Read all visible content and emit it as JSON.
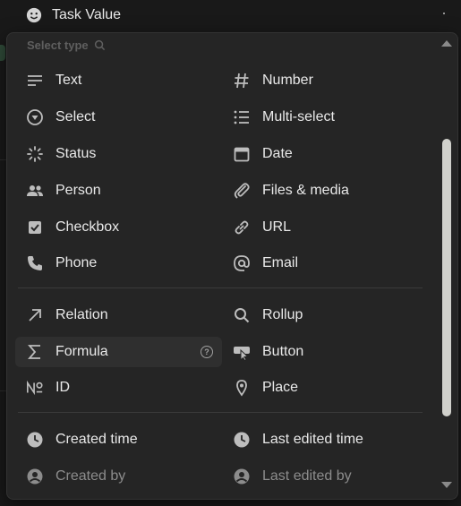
{
  "header": {
    "title": "Task Value",
    "icon": "smile-icon"
  },
  "popup": {
    "search_placeholder": "Select type",
    "help_symbol": "?",
    "sections": [
      {
        "items": [
          {
            "label": "Text",
            "icon": "text-lines-icon"
          },
          {
            "label": "Number",
            "icon": "hash-icon"
          },
          {
            "label": "Select",
            "icon": "select-circle-icon"
          },
          {
            "label": "Multi-select",
            "icon": "list-icon"
          },
          {
            "label": "Status",
            "icon": "status-spinner-icon"
          },
          {
            "label": "Date",
            "icon": "calendar-icon"
          },
          {
            "label": "Person",
            "icon": "people-icon"
          },
          {
            "label": "Files & media",
            "icon": "paperclip-icon"
          },
          {
            "label": "Checkbox",
            "icon": "checkbox-icon"
          },
          {
            "label": "URL",
            "icon": "link-icon"
          },
          {
            "label": "Phone",
            "icon": "phone-icon"
          },
          {
            "label": "Email",
            "icon": "at-icon"
          }
        ]
      },
      {
        "items": [
          {
            "label": "Relation",
            "icon": "arrow-up-right-icon"
          },
          {
            "label": "Rollup",
            "icon": "magnifier-icon"
          },
          {
            "label": "Formula",
            "icon": "sigma-icon",
            "highlighted": true
          },
          {
            "label": "Button",
            "icon": "cursor-button-icon"
          },
          {
            "label": "ID",
            "icon": "numero-icon"
          },
          {
            "label": "Place",
            "icon": "map-pin-icon"
          }
        ]
      },
      {
        "items": [
          {
            "label": "Created time",
            "icon": "clock-icon"
          },
          {
            "label": "Last edited time",
            "icon": "clock-icon"
          },
          {
            "label": "Created by",
            "icon": "user-circle-icon",
            "dim": true
          },
          {
            "label": "Last edited by",
            "icon": "user-circle-icon",
            "dim": true
          }
        ]
      }
    ]
  },
  "colors": {
    "background": "#191919",
    "popup": "#252525",
    "highlight": "#2f2f2f",
    "scroll_thumb": "#d0d0cb"
  }
}
